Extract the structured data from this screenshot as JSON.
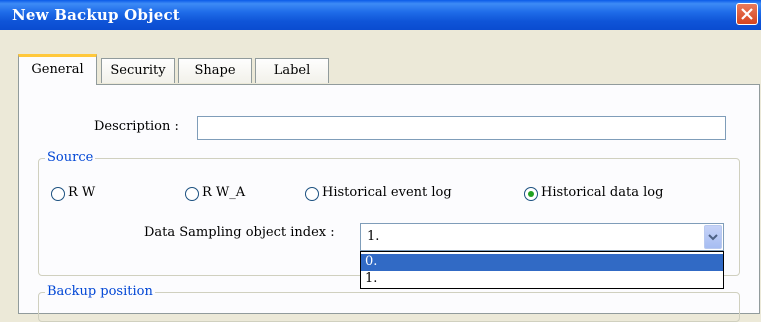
{
  "window": {
    "title": "New  Backup Object"
  },
  "tabs": [
    {
      "label": "General",
      "active": true
    },
    {
      "label": "Security",
      "active": false
    },
    {
      "label": "Shape",
      "active": false
    },
    {
      "label": "Label",
      "active": false
    }
  ],
  "description": {
    "label": "Description :",
    "value": ""
  },
  "source": {
    "legend": "Source",
    "options": [
      {
        "label": "R W",
        "checked": false
      },
      {
        "label": "R W_A",
        "checked": false
      },
      {
        "label": "Historical event log",
        "checked": false
      },
      {
        "label": "Historical data log",
        "checked": true
      }
    ],
    "sampling_label": "Data Sampling object index :",
    "sampling_value": "1.",
    "sampling_options": [
      "0.",
      "1."
    ],
    "highlighted_option": "0."
  },
  "backup_position": {
    "legend": "Backup position"
  },
  "colors": {
    "title_bar": "#0f55d8",
    "group_legend": "#0046d5",
    "selection": "#316ac5",
    "radio_dot": "#21a121"
  },
  "icons": {
    "close": "close-icon",
    "dropdown": "chevron-down-icon"
  }
}
